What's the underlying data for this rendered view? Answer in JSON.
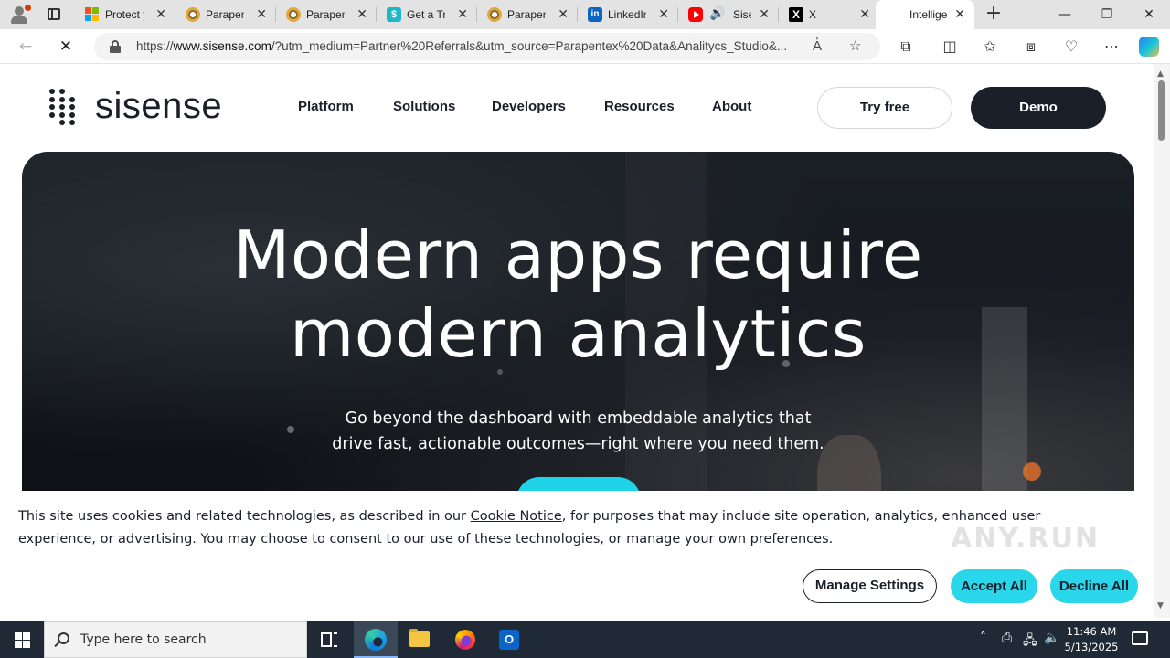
{
  "browser": {
    "tabs": [
      {
        "title": "Protect y",
        "icon": "microsoft-icon",
        "active": false
      },
      {
        "title": "Parapent",
        "icon": "parapentex-icon",
        "active": false
      },
      {
        "title": "Parapent",
        "icon": "parapentex-icon",
        "active": false
      },
      {
        "title": "Get a Tri",
        "icon": "sisense-icon",
        "active": false
      },
      {
        "title": "Parapent",
        "icon": "parapentex-icon",
        "active": false
      },
      {
        "title": "LinkedIn",
        "icon": "linkedin-icon",
        "active": false
      },
      {
        "title": "Sise",
        "icon": "youtube-icon",
        "active": false,
        "audio": true
      },
      {
        "title": "X",
        "icon": "x-icon",
        "active": false
      },
      {
        "title": "Intellige",
        "icon": "loading-icon",
        "active": true
      }
    ],
    "address": {
      "url_prefix": "https://",
      "url_host": "www.sisense.com",
      "url_rest": "/?utm_medium=Partner%20Referrals&utm_source=Parapentex%20Data&Analitycs_Studio&..."
    }
  },
  "site": {
    "logo_text": "sisense",
    "nav": [
      "Platform",
      "Solutions",
      "Developers",
      "Resources",
      "About"
    ],
    "try_free": "Try free",
    "demo": "Demo"
  },
  "hero": {
    "headline_line1": "Modern apps require",
    "headline_line2": "modern analytics",
    "subtitle_line1": "Go beyond the dashboard with embeddable analytics that",
    "subtitle_line2": "drive fast, actionable outcomes—right where you need them."
  },
  "cookie": {
    "text_before_link": "This site uses cookies and related technologies, as described in our ",
    "link": "Cookie Notice",
    "text_after_link": ", for purposes that may include site operation, analytics, enhanced user experience, or advertising. You may choose to consent to our use of these technologies, or manage your own preferences.",
    "manage": "Manage Settings",
    "accept": "Accept All",
    "decline": "Decline All"
  },
  "watermark": "ANY.RUN",
  "taskbar": {
    "search_placeholder": "Type here to search",
    "time": "11:46 AM",
    "date": "5/13/2025"
  },
  "colors": {
    "brand_dark": "#1b1f2a",
    "accent_cyan": "#29d6ea",
    "taskbar_bg": "#1f2a36"
  }
}
